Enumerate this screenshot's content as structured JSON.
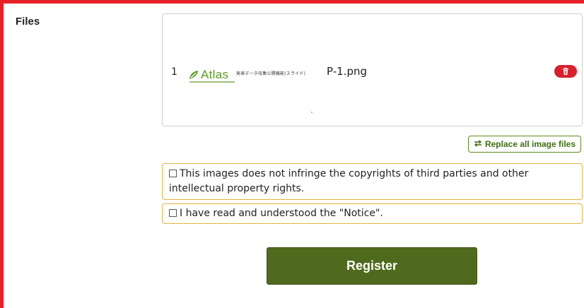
{
  "section": {
    "label": "Files"
  },
  "files": [
    {
      "index": "1",
      "thumbnail": {
        "logo_text": "Atlas",
        "caption": "発表データ収集公開機能(スライド)"
      },
      "name": "P-1.png",
      "delete_icon": "trash-icon"
    }
  ],
  "replace_button": {
    "label": "Replace all image files",
    "icon": "swap-arrows-icon"
  },
  "agreements": [
    {
      "text": "This images does not infringe the copyrights of third parties and other intellectual property rights.",
      "checked": false
    },
    {
      "text": "I have read and understood the \"Notice\".",
      "checked": false
    }
  ],
  "register_button": {
    "label": "Register"
  },
  "colors": {
    "frame": "#e8202a",
    "primary": "#4f6a1c",
    "accent_green": "#5c8d1e",
    "delete": "#d9202b",
    "notice_border": "#e3b53a"
  }
}
